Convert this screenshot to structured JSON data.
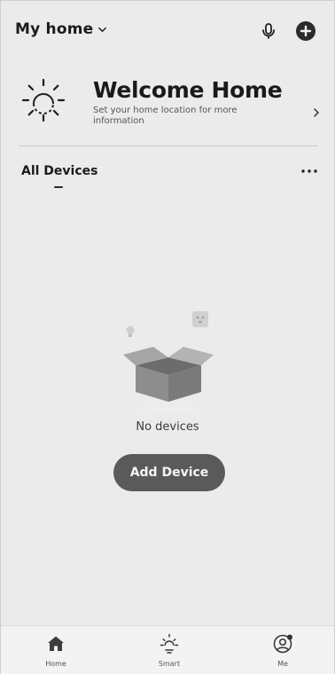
{
  "header": {
    "home_name": "My home",
    "chevron_icon": "chevron-down-icon",
    "mic_icon": "microphone-icon",
    "add_icon": "plus-circle-icon"
  },
  "welcome": {
    "icon": "sun-icon",
    "title": "Welcome Home",
    "subtitle": "Set your home location for more information",
    "arrow_icon": "chevron-right-icon"
  },
  "devices": {
    "tab_label": "All Devices",
    "more_icon": "more-horizontal-icon",
    "empty_text": "No devices",
    "add_button_label": "Add Device"
  },
  "nav": {
    "items": [
      {
        "label": "Home",
        "icon": "home-icon",
        "active": true
      },
      {
        "label": "Smart",
        "icon": "sun-outline-icon",
        "active": false
      },
      {
        "label": "Me",
        "icon": "user-icon",
        "active": false
      }
    ]
  },
  "colors": {
    "background": "#ebebeb",
    "text": "#1b1b1b",
    "button": "#5a5a5a",
    "nav_background": "#f3f3f3"
  }
}
